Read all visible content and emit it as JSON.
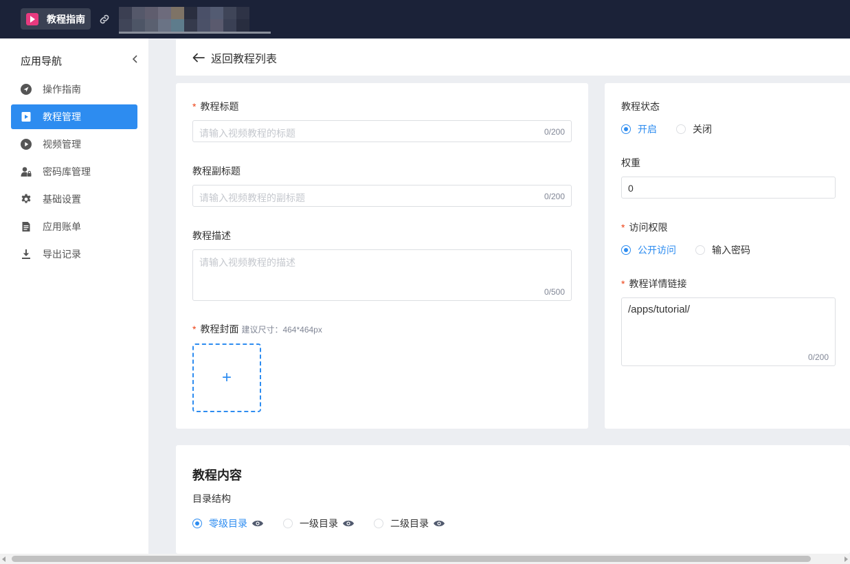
{
  "app": {
    "name": "教程指南",
    "brand_color": "#e83a7f",
    "topbar_color": "#1b2238"
  },
  "sidebar": {
    "title": "应用导航",
    "items": [
      {
        "label": "操作指南",
        "icon": "navigation-icon",
        "active": false
      },
      {
        "label": "教程管理",
        "icon": "tutorial-icon",
        "active": true
      },
      {
        "label": "视频管理",
        "icon": "play-circle-icon",
        "active": false
      },
      {
        "label": "密码库管理",
        "icon": "user-lock-icon",
        "active": false
      },
      {
        "label": "基础设置",
        "icon": "gear-icon",
        "active": false
      },
      {
        "label": "应用账单",
        "icon": "bill-icon",
        "active": false
      },
      {
        "label": "导出记录",
        "icon": "download-icon",
        "active": false
      }
    ]
  },
  "back": {
    "label": "返回教程列表"
  },
  "form": {
    "title": {
      "label": "教程标题",
      "placeholder": "请输入视频教程的标题",
      "count": "0/200"
    },
    "subtitle": {
      "label": "教程副标题",
      "placeholder": "请输入视频教程的副标题",
      "count": "0/200"
    },
    "description": {
      "label": "教程描述",
      "placeholder": "请输入视频教程的描述",
      "count": "0/500"
    },
    "cover": {
      "label": "教程封面",
      "hint": "建议尺寸：464*464px",
      "plus": "+"
    },
    "status": {
      "label": "教程状态",
      "options": [
        "开启",
        "关闭"
      ],
      "selected": "开启"
    },
    "weight": {
      "label": "权重",
      "value": "0"
    },
    "access": {
      "label": "访问权限",
      "options": [
        "公开访问",
        "输入密码"
      ],
      "selected": "公开访问"
    },
    "link": {
      "label": "教程详情链接",
      "value": "/apps/tutorial/",
      "count": "0/200"
    }
  },
  "content": {
    "title": "教程内容",
    "structure_label": "目录结构",
    "levels": [
      "零级目录",
      "一级目录",
      "二级目录"
    ],
    "selected": "零级目录"
  },
  "accent_color": "#2d8cf0",
  "required_color": "#ed4014"
}
